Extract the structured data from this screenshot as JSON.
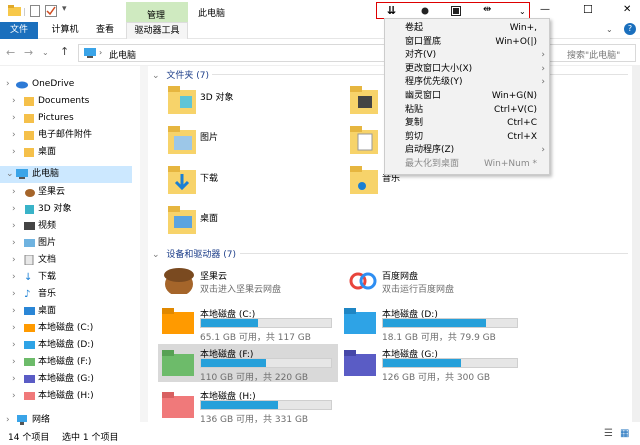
{
  "title_bar": {
    "context_tab": "管理",
    "title": "此电脑"
  },
  "window_controls": {
    "minimize": "—",
    "maximize": "☐",
    "close": "✕"
  },
  "ribbon": {
    "tabs": [
      "文件",
      "计算机",
      "查看",
      "驱动器工具"
    ],
    "file_color": "#1a6fbd",
    "manage_color": "#cfeac0"
  },
  "toolbar_buttons": [
    "rollup-icon",
    "pin-icon",
    "transparent-icon",
    "move-icon",
    "more-icon"
  ],
  "address": {
    "path": "此电脑",
    "search_placeholder": "搜索\"此电脑\""
  },
  "nav": {
    "items": [
      {
        "label": "OneDrive",
        "icon": "cloud-icon"
      },
      {
        "label": "Documents",
        "icon": "folder-icon"
      },
      {
        "label": "Pictures",
        "icon": "folder-icon"
      },
      {
        "label": "电子邮件附件",
        "icon": "folder-icon"
      },
      {
        "label": "桌面",
        "icon": "folder-icon"
      },
      {
        "label": "此电脑",
        "icon": "computer-icon"
      },
      {
        "label": "坚果云",
        "icon": "nut-icon"
      },
      {
        "label": "3D 对象",
        "icon": "cube-icon"
      },
      {
        "label": "视频",
        "icon": "video-icon"
      },
      {
        "label": "图片",
        "icon": "image-icon"
      },
      {
        "label": "文档",
        "icon": "document-icon"
      },
      {
        "label": "下载",
        "icon": "download-icon"
      },
      {
        "label": "音乐",
        "icon": "music-icon"
      },
      {
        "label": "桌面",
        "icon": "desktop-icon"
      },
      {
        "label": "本地磁盘 (C:)",
        "icon": "drive-c-icon"
      },
      {
        "label": "本地磁盘 (D:)",
        "icon": "drive-d-icon"
      },
      {
        "label": "本地磁盘 (F:)",
        "icon": "drive-f-icon"
      },
      {
        "label": "本地磁盘 (G:)",
        "icon": "drive-g-icon"
      },
      {
        "label": "本地磁盘 (H:)",
        "icon": "drive-h-icon"
      },
      {
        "label": "网络",
        "icon": "network-icon"
      }
    ]
  },
  "folders_section": {
    "header": "文件夹 (7)",
    "items": [
      "3D 对象",
      "视频",
      "图片",
      "文档",
      "下载",
      "音乐",
      "桌面"
    ]
  },
  "drives_section": {
    "header": "设备和驱动器 (7)",
    "apps": [
      {
        "name": "坚果云",
        "desc": "双击进入坚果云网盘"
      },
      {
        "name": "百度网盘",
        "desc": "双击运行百度网盘"
      }
    ],
    "drives": [
      {
        "name": "本地磁盘 (C:)",
        "caption": "65.1 GB 可用，共 117 GB",
        "used": 0.44,
        "color": "#ff9a00"
      },
      {
        "name": "本地磁盘 (D:)",
        "caption": "18.1 GB 可用，共 79.9 GB",
        "used": 0.77,
        "color": "#2ea3e6"
      },
      {
        "name": "本地磁盘 (F:)",
        "caption": "110 GB 可用，共 220 GB",
        "used": 0.5,
        "color": "#6dbb6a"
      },
      {
        "name": "本地磁盘 (G:)",
        "caption": "126 GB 可用，共 300 GB",
        "used": 0.58,
        "color": "#5a5cc5"
      },
      {
        "name": "本地磁盘 (H:)",
        "caption": "136 GB 可用，共 331 GB",
        "used": 0.59,
        "color": "#f0797a"
      }
    ]
  },
  "status": {
    "count": "14 个项目",
    "selected": "选中 1 个项目"
  },
  "context_menu": {
    "items": [
      {
        "label": "卷起",
        "shortcut": "Win+,",
        "arrow": "",
        "disabled": false
      },
      {
        "label": "窗口置底",
        "shortcut": "Win+O(|)",
        "arrow": "",
        "disabled": false
      },
      {
        "label": "对齐(V)",
        "shortcut": "",
        "arrow": "›",
        "disabled": false
      },
      {
        "label": "更改窗口大小(X)",
        "shortcut": "",
        "arrow": "›",
        "disabled": false
      },
      {
        "label": "程序优先级(Y)",
        "shortcut": "",
        "arrow": "›",
        "disabled": false
      },
      {
        "label": "幽灵窗口",
        "shortcut": "Win+G(N)",
        "arrow": "",
        "disabled": false
      },
      {
        "label": "粘贴",
        "shortcut": "Ctrl+V(C)",
        "arrow": "",
        "disabled": false
      },
      {
        "label": "复制",
        "shortcut": "Ctrl+C",
        "arrow": "",
        "disabled": false
      },
      {
        "label": "剪切",
        "shortcut": "Ctrl+X",
        "arrow": "",
        "disabled": false
      },
      {
        "label": "启动程序(Z)",
        "shortcut": "",
        "arrow": "›",
        "disabled": false
      },
      {
        "label": "最大化到桌面",
        "shortcut": "Win+Num *",
        "arrow": "",
        "disabled": true
      }
    ]
  }
}
